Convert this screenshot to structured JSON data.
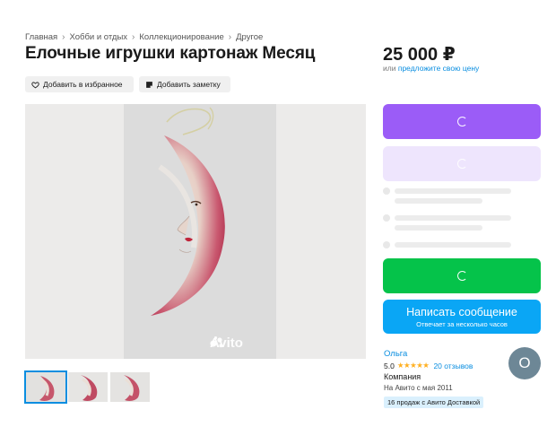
{
  "breadcrumb": [
    "Главная",
    "Хобби и отдых",
    "Коллекционирование",
    "Другое"
  ],
  "title": "Елочные игрушки картонаж Месяц",
  "price": {
    "value": "25 000 ₽",
    "prefix": "или",
    "offer_link": "предложите свою цену"
  },
  "actions": {
    "favorite": "Добавить в избранное",
    "note": "Добавить заметку"
  },
  "photo": {
    "watermark": "Avito"
  },
  "thumbnails_count": 3,
  "contact": {
    "message_button": "Написать сообщение",
    "message_sub": "Отвечает за несколько часов"
  },
  "seller": {
    "name": "Ольга",
    "rating": "5.0",
    "stars": "★★★★★",
    "reviews": "20 отзывов",
    "type": "Компания",
    "since": "На Авито с мая 2011",
    "badge": "16 продаж с Авито Доставкой",
    "avatar_letter": "О"
  },
  "colors": {
    "violet": "#9b5cf7",
    "lavender": "#eee5fd",
    "green": "#05c34a",
    "blue": "#0aa6f5",
    "link": "#0a8ee0"
  }
}
